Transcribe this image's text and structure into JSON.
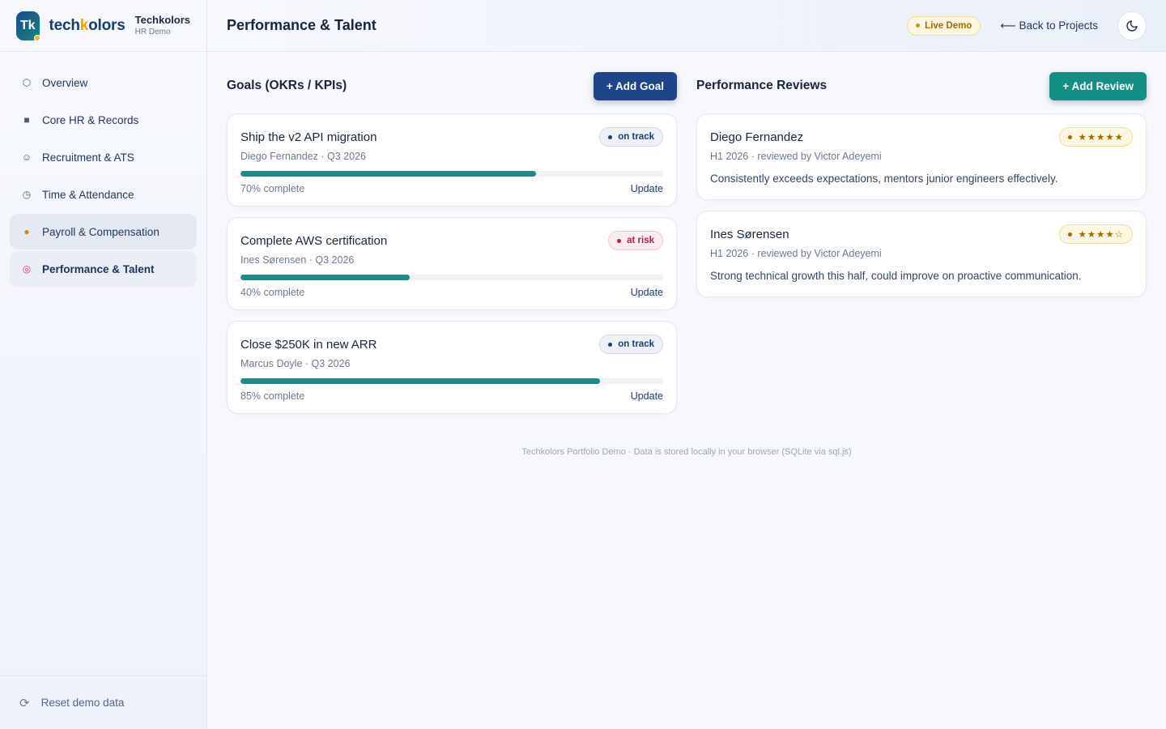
{
  "brand": {
    "logo_text": "Tk",
    "word_pre": "tech",
    "word_k": "k",
    "word_post": "olors",
    "name": "Techkolors",
    "subtitle": "HR Demo"
  },
  "nav": {
    "items": [
      {
        "icon": "⬡",
        "label": "Overview"
      },
      {
        "icon": "■",
        "label": "Core HR & Records"
      },
      {
        "icon": "☺",
        "label": "Recruitment & ATS"
      },
      {
        "icon": "◷",
        "label": "Time & Attendance"
      },
      {
        "icon": "●",
        "label": "Payroll & Compensation"
      },
      {
        "icon": "◎",
        "label": "Performance & Talent"
      }
    ],
    "reset_label": "Reset demo data",
    "reset_icon": "⟳"
  },
  "header": {
    "title": "Performance & Talent",
    "live_badge": "Live Demo",
    "back_link": "⟵ Back to Projects",
    "theme_icon": "moon-icon"
  },
  "goals": {
    "title": "Goals (OKRs / KPIs)",
    "add_label": "+ Add Goal",
    "items": [
      {
        "title": "Ship the v2 API migration",
        "owner": "Diego Fernandez · Q3 2026",
        "status": "on track",
        "progress": 70,
        "progress_label": "70% complete",
        "update_label": "Update"
      },
      {
        "title": "Complete AWS certification",
        "owner": "Ines Sørensen · Q3 2026",
        "status": "at risk",
        "progress": 40,
        "progress_label": "40% complete",
        "update_label": "Update"
      },
      {
        "title": "Close $250K in new ARR",
        "owner": "Marcus Doyle · Q3 2026",
        "status": "on track",
        "progress": 85,
        "progress_label": "85% complete",
        "update_label": "Update"
      }
    ]
  },
  "reviews": {
    "title": "Performance Reviews",
    "add_label": "+ Add Review",
    "items": [
      {
        "name": "Diego Fernandez",
        "meta": "H1 2026 · reviewed by Victor Adeyemi",
        "stars": "★★★★★",
        "text": "Consistently exceeds expectations, mentors junior engineers effectively."
      },
      {
        "name": "Ines Sørensen",
        "meta": "H1 2026 · reviewed by Victor Adeyemi",
        "stars": "★★★★☆",
        "text": "Strong technical growth this half, could improve on proactive communication."
      }
    ]
  },
  "footer": {
    "note": "Techkolors Portfolio Demo · Data is stored locally in your browser (SQLite via sql.js)"
  },
  "colors": {
    "navy": "#1d4587",
    "teal": "#148f85",
    "amber": "#a36a00",
    "danger": "#b4223b"
  }
}
